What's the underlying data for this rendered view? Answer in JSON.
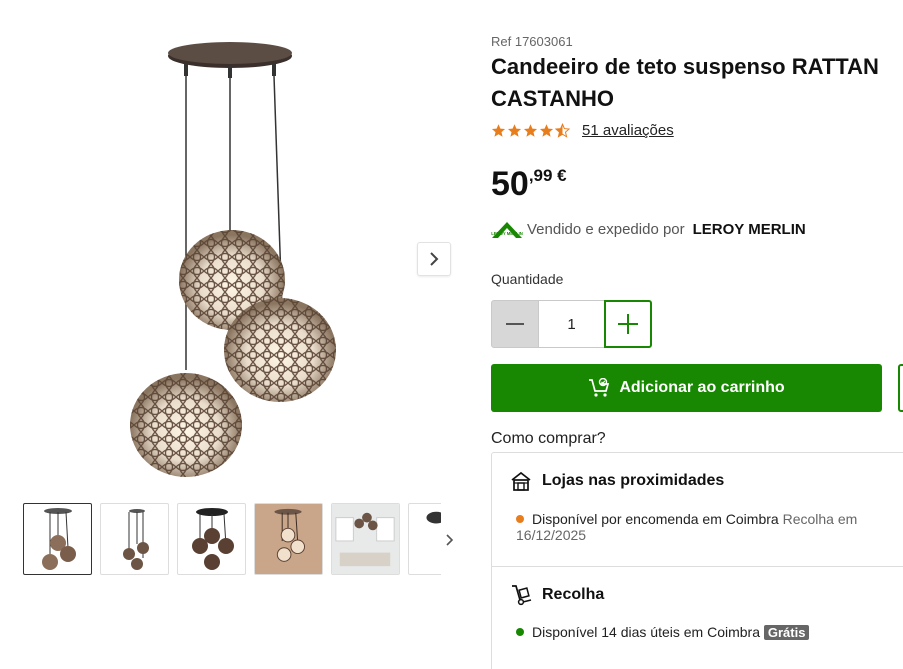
{
  "product": {
    "ref": "Ref 17603061",
    "title": "Candeeiro de teto suspenso RATTAN CASTANHO",
    "rating": 4.5,
    "reviews": "51 avaliações",
    "price_integer": "50",
    "price_decimal": ",99 €",
    "seller_prefix": "Vendido e expedido por",
    "seller_name": "LEROY MERLIN",
    "logo_text": "LEROY MERLIN"
  },
  "quantity": {
    "label": "Quantidade",
    "value": "1"
  },
  "cart": {
    "button_label": "Adicionar ao carrinho"
  },
  "how_to_buy": {
    "title": "Como comprar?",
    "stores": {
      "title": "Lojas nas proximidades",
      "status": "Disponível por encomenda em Coimbra",
      "pickup": "Recolha em 16/12/2025",
      "status_color": "#e87d1e"
    },
    "pickup": {
      "title": "Recolha",
      "status": "Disponível 14 dias úteis em Coimbra",
      "badge": "Grátis",
      "status_color": "#188803"
    }
  },
  "colors": {
    "brand_green": "#188803",
    "star_orange": "#e87d1e"
  },
  "gallery": {
    "thumbnails": [
      "lamp-front",
      "lamp-side",
      "lamp-dark",
      "lamp-room-warm",
      "lamp-bedroom",
      "lamp-partial"
    ]
  }
}
